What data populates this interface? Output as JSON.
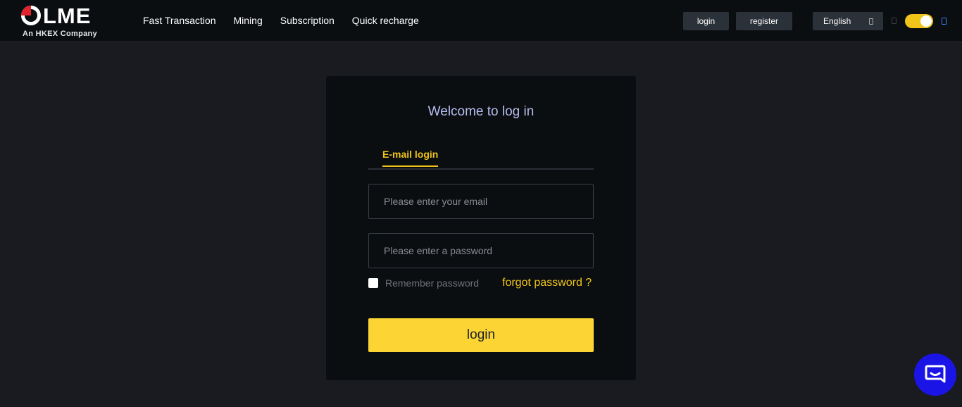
{
  "header": {
    "logo": {
      "name": "LME",
      "tagline": "An HKEX Company"
    },
    "nav": [
      {
        "label": "Fast Transaction"
      },
      {
        "label": "Mining"
      },
      {
        "label": "Subscription"
      },
      {
        "label": "Quick recharge"
      }
    ],
    "login_label": "login",
    "register_label": "register",
    "language": "English",
    "theme_toggle_on": true
  },
  "card": {
    "title": "Welcome to log in",
    "tab_label": "E-mail login",
    "email_placeholder": "Please enter your email",
    "email_value": "",
    "password_placeholder": "Please enter a password",
    "password_value": "",
    "remember_label": "Remember password",
    "remember_checked": false,
    "forgot_label": "forgot password ?",
    "submit_label": "login"
  },
  "colors": {
    "accent": "#fcd535",
    "link": "#f0c419",
    "title": "#b7bdf0",
    "background": "#1a1b20",
    "card": "#0b0e11",
    "chat": "#1a15e6"
  },
  "icons": {
    "chat": "chat-bubble-icon",
    "language_dropdown": "chevron-down-icon",
    "theme_dark": "moon-icon",
    "theme_light": "sun-icon"
  }
}
